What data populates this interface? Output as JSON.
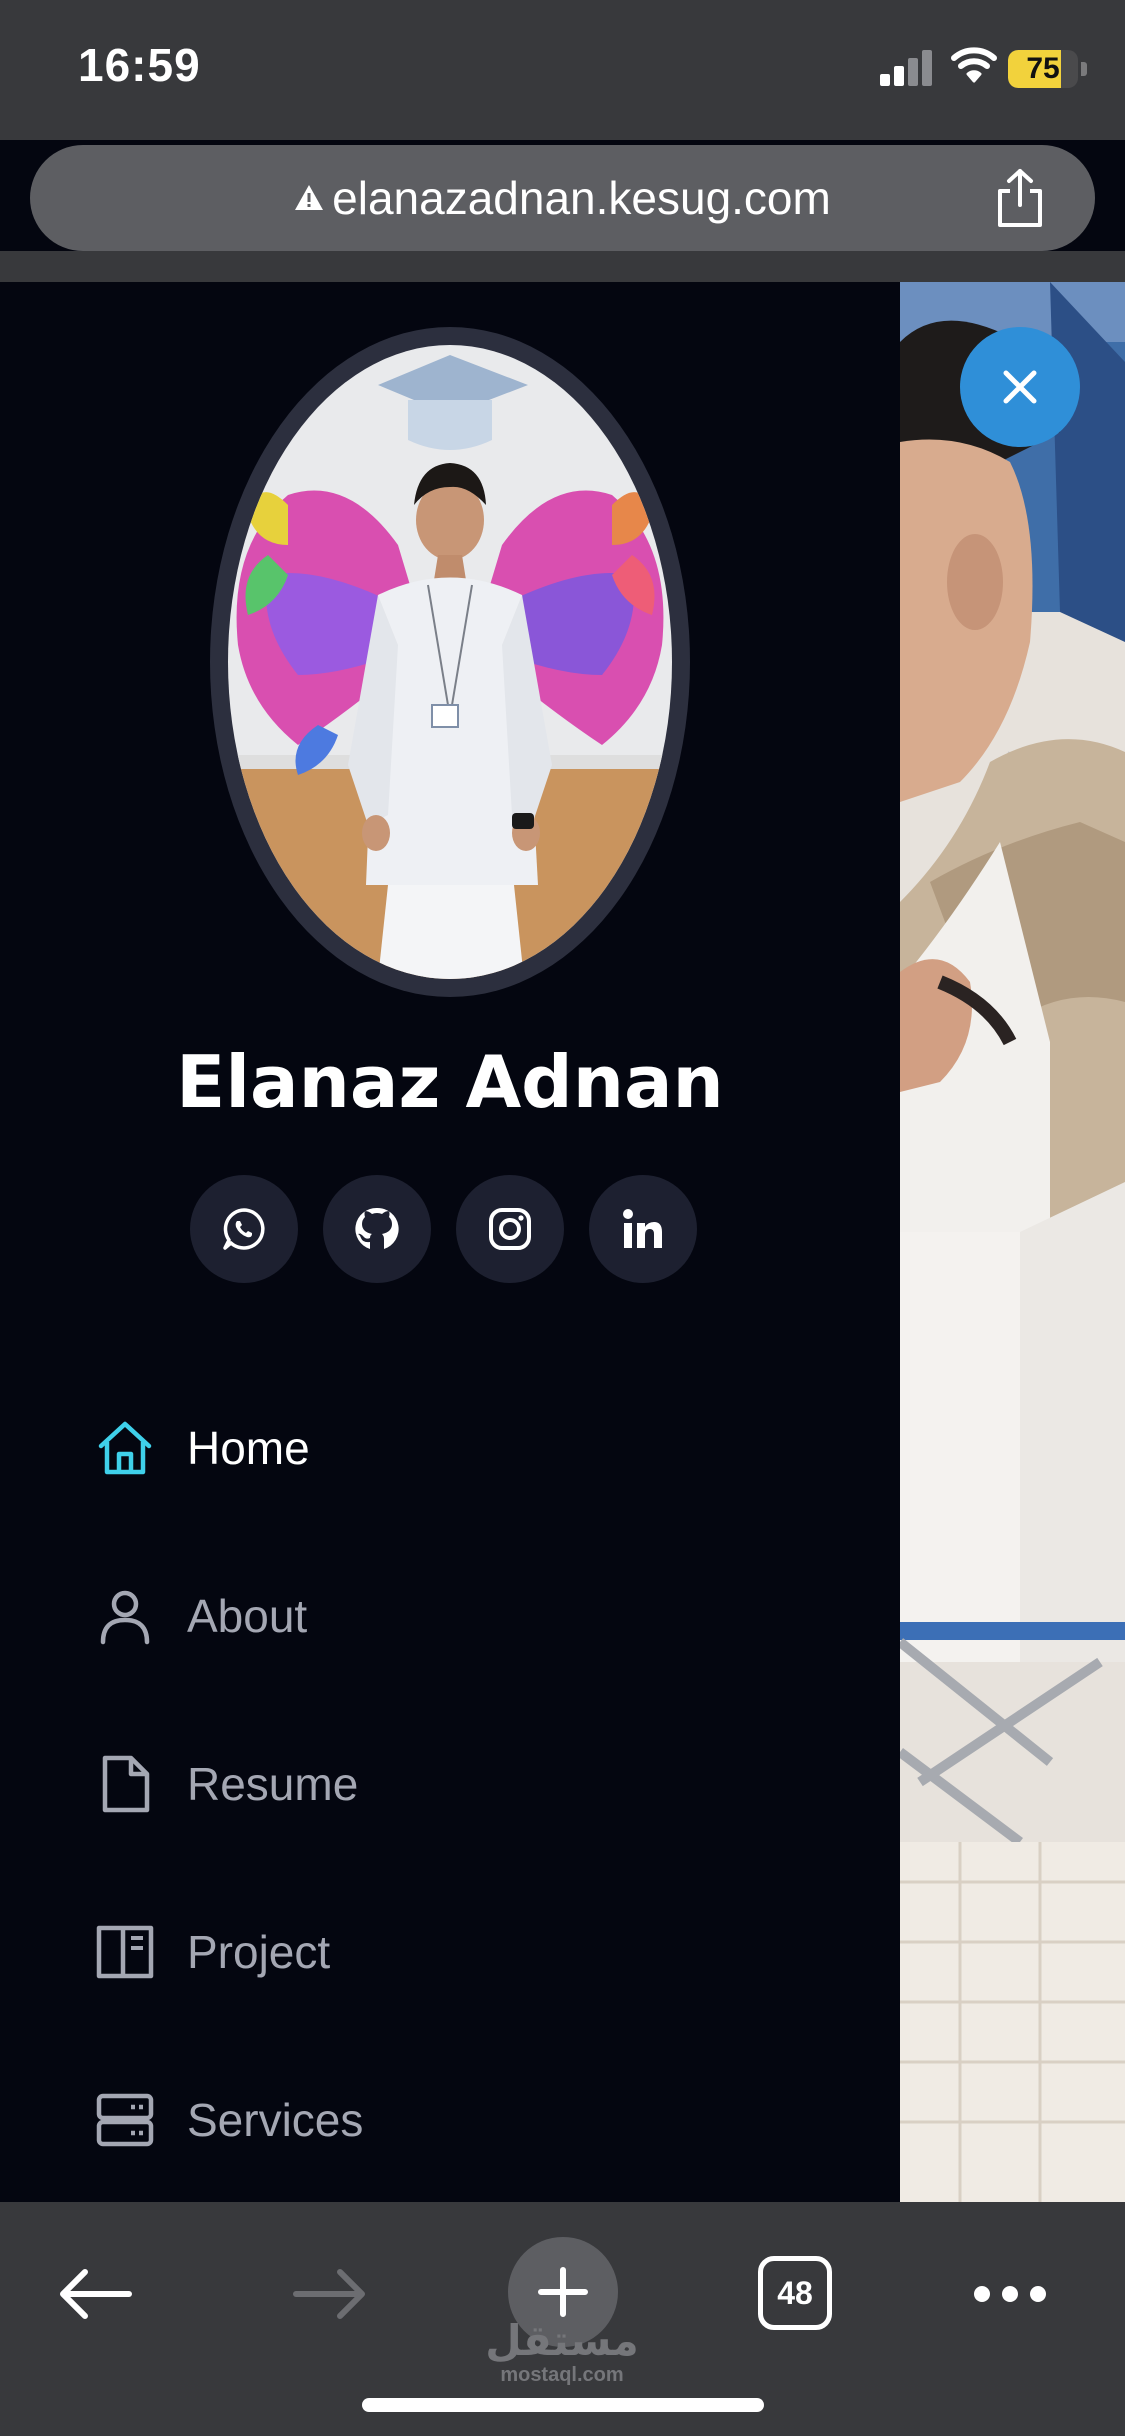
{
  "status_bar": {
    "time": "16:59",
    "battery_level": "75",
    "battery_fraction": 0.75,
    "colors": {
      "battery": "#f2d23c"
    }
  },
  "browser": {
    "url": "elanazadnan.kesug.com",
    "tab_count": "48"
  },
  "profile": {
    "name": "Elanaz Adnan",
    "social": [
      {
        "icon": "whatsapp-icon"
      },
      {
        "icon": "github-icon"
      },
      {
        "icon": "instagram-icon"
      },
      {
        "icon": "linkedin-icon"
      }
    ]
  },
  "nav": {
    "items": [
      {
        "label": "Home",
        "icon": "home-icon",
        "active": true
      },
      {
        "label": "About",
        "icon": "user-icon",
        "active": false
      },
      {
        "label": "Resume",
        "icon": "file-icon",
        "active": false
      },
      {
        "label": "Project",
        "icon": "layout-icon",
        "active": false
      },
      {
        "label": "Services",
        "icon": "server-icon",
        "active": false
      }
    ],
    "colors": {
      "active_icon": "#3fd0ea",
      "inactive": "#a4a7b3",
      "close_button": "#2f8fd8"
    }
  },
  "watermark": {
    "arabic": "مستقل",
    "latin": "mostaql.com"
  }
}
